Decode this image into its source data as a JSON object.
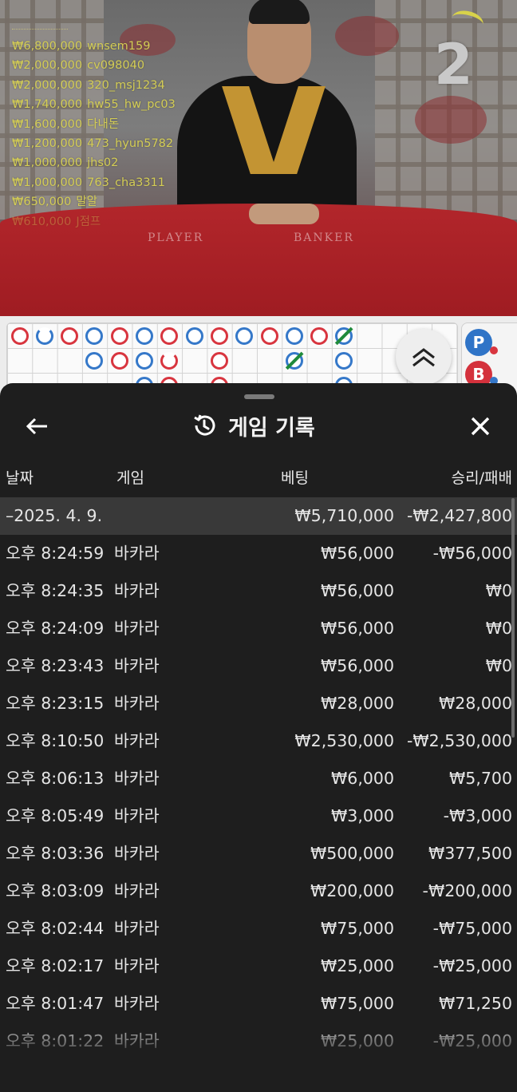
{
  "stream": {
    "round_number": "2",
    "table_labels": {
      "player": "PLAYER",
      "banker": "BANKER"
    },
    "winners": [
      {
        "amount": "₩6,800,000",
        "user": "wnsem159"
      },
      {
        "amount": "₩2,000,000",
        "user": "cv098040"
      },
      {
        "amount": "₩2,000,000",
        "user": "320_msj1234"
      },
      {
        "amount": "₩1,740,000",
        "user": "hw55_hw_pc03"
      },
      {
        "amount": "₩1,600,000",
        "user": "다내돈"
      },
      {
        "amount": "₩1,200,000",
        "user": "473_hyun5782"
      },
      {
        "amount": "₩1,000,000",
        "user": "jhs02"
      },
      {
        "amount": "₩1,000,000",
        "user": "763_cha3311"
      },
      {
        "amount": "₩650,000",
        "user": "말알"
      },
      {
        "amount": "₩610,000",
        "user": "J점프"
      }
    ]
  },
  "side_panel": {
    "player_letter": "P",
    "banker_letter": "B"
  },
  "sheet": {
    "title": "게임 기록",
    "columns": {
      "date": "날짜",
      "game": "게임",
      "bet": "베팅",
      "result": "승리/패배"
    },
    "date_group": {
      "date": "–2025. 4. 9.",
      "bet_total": "₩5,710,000",
      "result_total": "-₩2,427,800"
    },
    "rows": [
      {
        "time": "오후 8:24:59",
        "game": "바카라",
        "bet": "₩56,000",
        "result": "-₩56,000"
      },
      {
        "time": "오후 8:24:35",
        "game": "바카라",
        "bet": "₩56,000",
        "result": "₩0"
      },
      {
        "time": "오후 8:24:09",
        "game": "바카라",
        "bet": "₩56,000",
        "result": "₩0"
      },
      {
        "time": "오후 8:23:43",
        "game": "바카라",
        "bet": "₩56,000",
        "result": "₩0"
      },
      {
        "time": "오후 8:23:15",
        "game": "바카라",
        "bet": "₩28,000",
        "result": "₩28,000"
      },
      {
        "time": "오후 8:10:50",
        "game": "바카라",
        "bet": "₩2,530,000",
        "result": "-₩2,530,000"
      },
      {
        "time": "오후 8:06:13",
        "game": "바카라",
        "bet": "₩6,000",
        "result": "₩5,700"
      },
      {
        "time": "오후 8:05:49",
        "game": "바카라",
        "bet": "₩3,000",
        "result": "-₩3,000"
      },
      {
        "time": "오후 8:03:36",
        "game": "바카라",
        "bet": "₩500,000",
        "result": "₩377,500"
      },
      {
        "time": "오후 8:03:09",
        "game": "바카라",
        "bet": "₩200,000",
        "result": "-₩200,000"
      },
      {
        "time": "오후 8:02:44",
        "game": "바카라",
        "bet": "₩75,000",
        "result": "-₩75,000"
      },
      {
        "time": "오후 8:02:17",
        "game": "바카라",
        "bet": "₩25,000",
        "result": "-₩25,000"
      },
      {
        "time": "오후 8:01:47",
        "game": "바카라",
        "bet": "₩75,000",
        "result": "₩71,250"
      },
      {
        "time": "오후 8:01:22",
        "game": "바카라",
        "bet": "₩25,000",
        "result": "-₩25,000"
      }
    ]
  },
  "colors": {
    "player_blue": "#3578c9",
    "banker_red": "#d8353f",
    "tie_green": "#1f8a3b",
    "winner_text": "#d4cd55"
  }
}
